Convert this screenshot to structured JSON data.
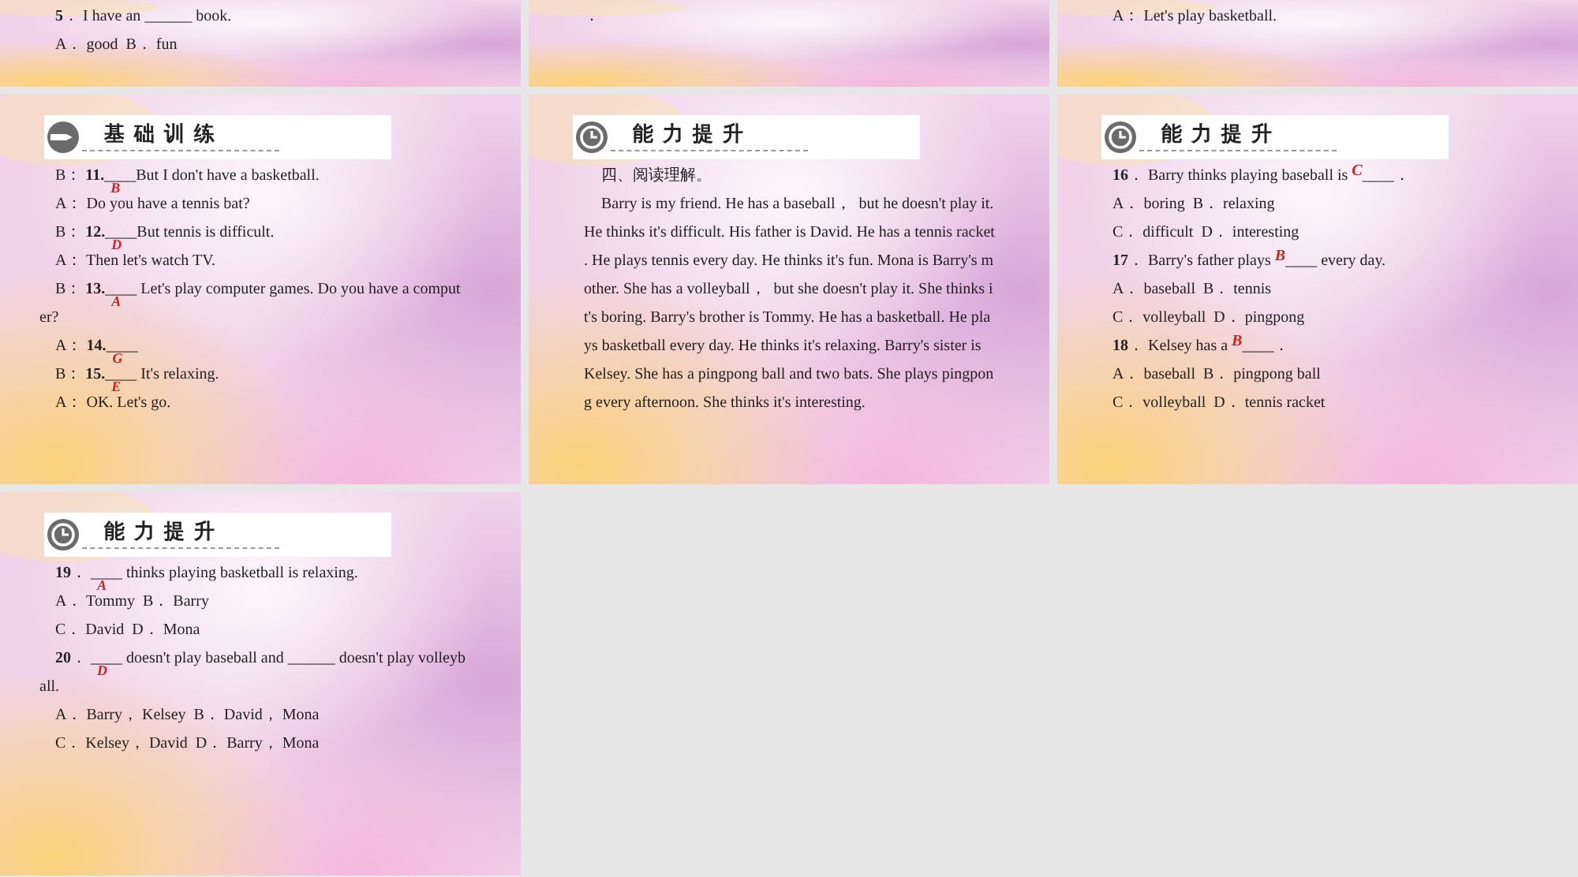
{
  "slides": [
    {
      "lines": [
        {
          "kind": "plain",
          "parts": [
            {
              "kind": "text",
              "text": "**5**． I have an ______ book."
            }
          ]
        },
        {
          "kind": "plain",
          "parts": [
            {
              "kind": "text",
              "text": "A． good  B． fun"
            }
          ]
        }
      ]
    },
    {
      "lines": [
        {
          "kind": "plain",
          "parts": [
            {
              "kind": "text",
              "text": "．"
            }
          ]
        }
      ]
    },
    {
      "lines": [
        {
          "kind": "plain",
          "parts": [
            {
              "kind": "text",
              "text": "A： Let's play basketball."
            }
          ]
        }
      ]
    },
    {
      "header": {
        "kind": "basic",
        "title": "基础训练"
      },
      "lines": [
        {
          "kind": "plain",
          "parts": [
            {
              "kind": "text",
              "text": "B： **11.**"
            },
            {
              "kind": "blank",
              "blank": "____",
              "answer": "B"
            },
            {
              "kind": "text",
              "text": "But I don't have a basketball."
            }
          ]
        },
        {
          "kind": "plain",
          "parts": [
            {
              "kind": "text",
              "text": "A： Do you have a tennis bat?"
            }
          ]
        },
        {
          "kind": "plain",
          "parts": [
            {
              "kind": "text",
              "text": "B： **12.**"
            },
            {
              "kind": "blank",
              "blank": "____",
              "answer": "D"
            },
            {
              "kind": "text",
              "text": "But tennis is difficult."
            }
          ]
        },
        {
          "kind": "plain",
          "parts": [
            {
              "kind": "text",
              "text": "A： Then let's watch TV."
            }
          ]
        },
        {
          "kind": "plain",
          "parts": [
            {
              "kind": "text",
              "text": "B： **13.**"
            },
            {
              "kind": "blank",
              "blank": "____",
              "answer": "A"
            },
            {
              "kind": "text",
              "text": " Let's play computer games. Do you have a comput"
            }
          ]
        },
        {
          "kind": "wrap",
          "parts": [
            {
              "kind": "text",
              "text": "er?"
            }
          ]
        },
        {
          "kind": "plain",
          "parts": [
            {
              "kind": "text",
              "text": "A： **14.**"
            },
            {
              "kind": "blank",
              "blank": "____",
              "answer": "G"
            }
          ]
        },
        {
          "kind": "plain",
          "parts": [
            {
              "kind": "text",
              "text": "B： **15.**"
            },
            {
              "kind": "blank",
              "blank": "____",
              "answer": "E"
            },
            {
              "kind": "text",
              "text": " It's relaxing."
            }
          ]
        },
        {
          "kind": "plain",
          "parts": [
            {
              "kind": "text",
              "text": "A： OK. Let's go."
            }
          ]
        }
      ]
    },
    {
      "header": {
        "kind": "advanced",
        "title": "能力提升"
      },
      "lines": [
        {
          "kind": "first",
          "parts": [
            {
              "kind": "text",
              "text": "四、阅读理解。"
            }
          ]
        },
        {
          "kind": "first",
          "parts": [
            {
              "kind": "text",
              "text": "Barry is my friend. He has a baseball，  but he doesn't play it."
            }
          ]
        },
        {
          "kind": "plain",
          "parts": [
            {
              "kind": "text",
              "text": "He thinks it's difficult. His father is David. He has a tennis racket"
            }
          ]
        },
        {
          "kind": "plain",
          "parts": [
            {
              "kind": "text",
              "text": ". He plays tennis every day. He thinks it's fun. Mona is Barry's m"
            }
          ]
        },
        {
          "kind": "plain",
          "parts": [
            {
              "kind": "text",
              "text": "other. She has a volleyball，  but she doesn't play it. She thinks i"
            }
          ]
        },
        {
          "kind": "plain",
          "parts": [
            {
              "kind": "text",
              "text": "t's boring. Barry's brother is Tommy. He has a basketball. He pla"
            }
          ]
        },
        {
          "kind": "plain",
          "parts": [
            {
              "kind": "text",
              "text": "ys basketball every day. He thinks it's relaxing. Barry's sister is"
            }
          ]
        },
        {
          "kind": "plain",
          "parts": [
            {
              "kind": "text",
              "text": "Kelsey. She has a pingpong ball and two bats. She plays pingpon"
            }
          ]
        },
        {
          "kind": "plain",
          "parts": [
            {
              "kind": "text",
              "text": "g every afternoon. She thinks it's interesting."
            }
          ]
        }
      ]
    },
    {
      "header": {
        "kind": "advanced",
        "title": "能力提升"
      },
      "lines": [
        {
          "kind": "plain",
          "parts": [
            {
              "kind": "text",
              "text": "**16**． Barry thinks playing baseball is "
            },
            {
              "kind": "filled",
              "blank": "____",
              "answer": "C"
            },
            {
              "kind": "text",
              "text": "．"
            }
          ]
        },
        {
          "kind": "plain",
          "parts": [
            {
              "kind": "text",
              "text": "A． boring  B． relaxing"
            }
          ]
        },
        {
          "kind": "plain",
          "parts": [
            {
              "kind": "text",
              "text": "C． difficult  D． interesting"
            }
          ]
        },
        {
          "kind": "plain",
          "parts": [
            {
              "kind": "text",
              "text": "**17**． Barry's father plays "
            },
            {
              "kind": "filled",
              "blank": "____",
              "answer": "B"
            },
            {
              "kind": "text",
              "text": " every day."
            }
          ]
        },
        {
          "kind": "plain",
          "parts": [
            {
              "kind": "text",
              "text": "A． baseball  B． tennis"
            }
          ]
        },
        {
          "kind": "plain",
          "parts": [
            {
              "kind": "text",
              "text": "C． volleyball  D． pingpong"
            }
          ]
        },
        {
          "kind": "plain",
          "parts": [
            {
              "kind": "text",
              "text": "**18**． Kelsey has a "
            },
            {
              "kind": "filled",
              "blank": "____",
              "answer": "B"
            },
            {
              "kind": "text",
              "text": "．"
            }
          ]
        },
        {
          "kind": "plain",
          "parts": [
            {
              "kind": "text",
              "text": "A． baseball  B． pingpong ball"
            }
          ]
        },
        {
          "kind": "plain",
          "parts": [
            {
              "kind": "text",
              "text": "C． volleyball  D． tennis racket"
            }
          ]
        }
      ]
    },
    {
      "header": {
        "kind": "advanced",
        "title": "能力提升"
      },
      "lines": [
        {
          "kind": "plain",
          "parts": [
            {
              "kind": "text",
              "text": "**19**． "
            },
            {
              "kind": "blank",
              "blank": "____",
              "answer": "A"
            },
            {
              "kind": "text",
              "text": " thinks playing basketball is relaxing."
            }
          ]
        },
        {
          "kind": "plain",
          "parts": [
            {
              "kind": "text",
              "text": "A． Tommy  B． Barry"
            }
          ]
        },
        {
          "kind": "plain",
          "parts": [
            {
              "kind": "text",
              "text": "C． David  D． Mona"
            }
          ]
        },
        {
          "kind": "plain",
          "parts": [
            {
              "kind": "text",
              "text": "**20**． "
            },
            {
              "kind": "blank",
              "blank": "____",
              "answer": "D"
            },
            {
              "kind": "text",
              "text": " doesn't play baseball and ______ doesn't play volleyb"
            }
          ]
        },
        {
          "kind": "wrap",
          "parts": [
            {
              "kind": "text",
              "text": "all."
            }
          ]
        },
        {
          "kind": "plain",
          "parts": [
            {
              "kind": "text",
              "text": "A． Barry， Kelsey  B． David， Mona"
            }
          ]
        },
        {
          "kind": "plain",
          "parts": [
            {
              "kind": "text",
              "text": "C． Kelsey， David  D． Barry， Mona"
            }
          ]
        }
      ]
    }
  ]
}
